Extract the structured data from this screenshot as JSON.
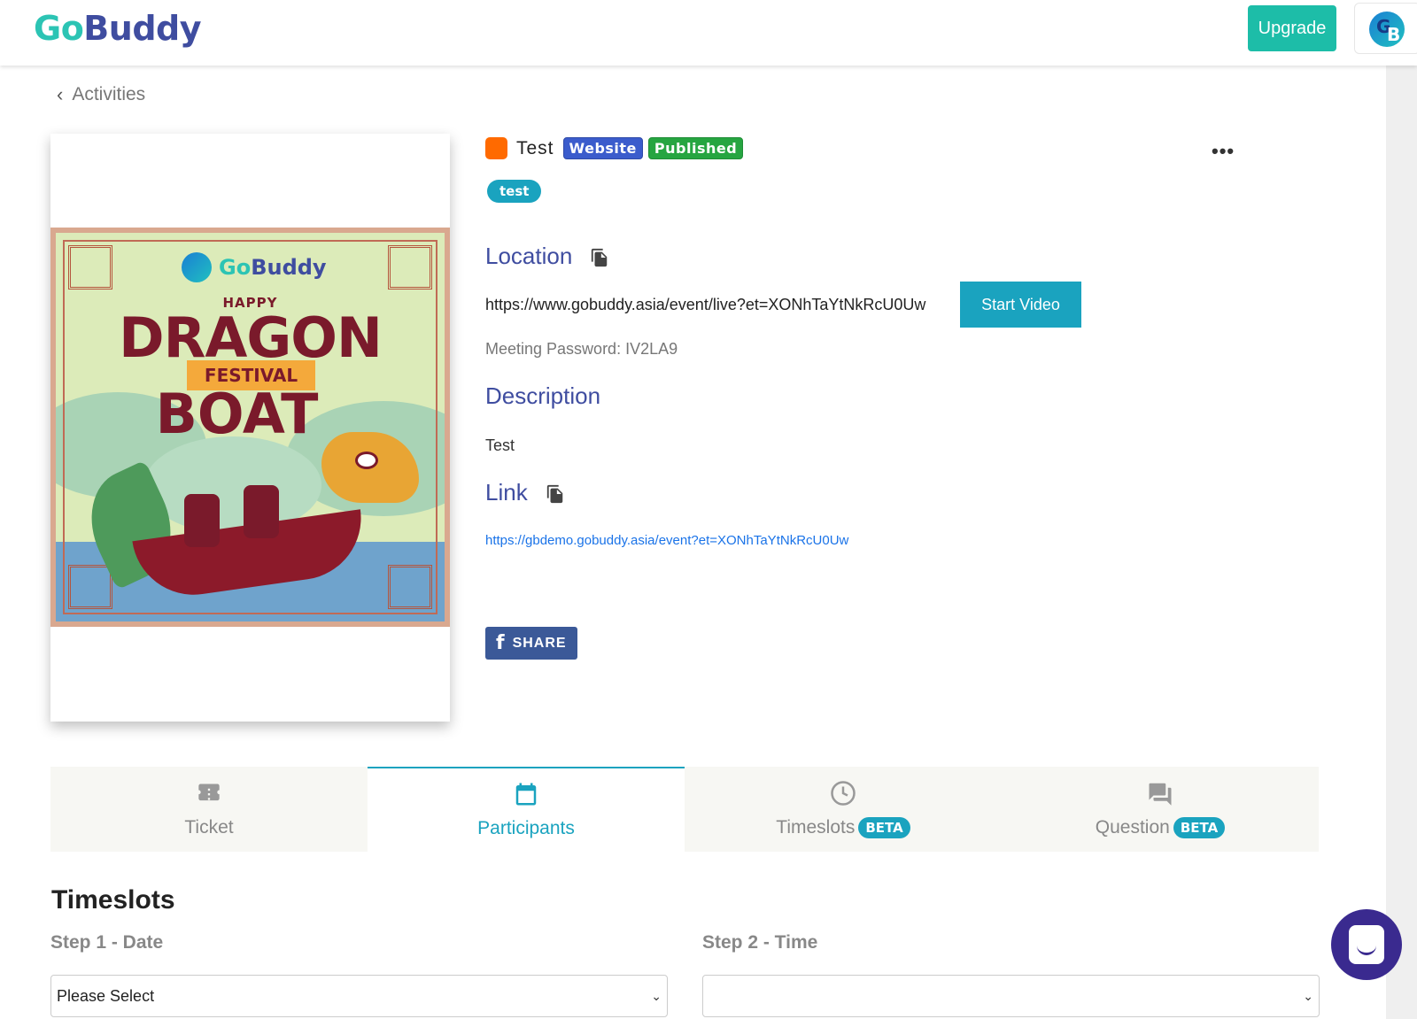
{
  "header": {
    "logo_go": "Go",
    "logo_buddy": "Buddy",
    "upgrade_label": "Upgrade",
    "avatar_g": "G",
    "avatar_b": "B"
  },
  "breadcrumb": {
    "back_label": "Activities"
  },
  "poster": {
    "logo_go": "Go",
    "logo_buddy": "Buddy",
    "happy": "HAPPY",
    "dragon": "DRAGON",
    "festival": "FESTIVAL",
    "boat": "BOAT"
  },
  "event": {
    "color": "#ff6a00",
    "title": "Test",
    "badge_website": "Website",
    "badge_published": "Published",
    "more": "•••",
    "tag": "test",
    "location_heading": "Location",
    "location_url": "https://www.gobuddy.asia/event/live?et=XONhTaYtNkRcU0Uw",
    "start_video_label": "Start Video",
    "meeting_password": "Meeting Password: IV2LA9",
    "description_heading": "Description",
    "description_text": "Test",
    "link_heading": "Link",
    "link_url": "https://gbdemo.gobuddy.asia/event?et=XONhTaYtNkRcU0Uw",
    "share_label": "SHARE",
    "share_icon": "f"
  },
  "tabs": [
    {
      "label": "Ticket",
      "icon": "ticket-icon",
      "active": false,
      "beta": ""
    },
    {
      "label": "Participants",
      "icon": "calendar-icon",
      "active": true,
      "beta": ""
    },
    {
      "label": "Timeslots",
      "icon": "clock-icon",
      "active": false,
      "beta": "BETA"
    },
    {
      "label": "Question",
      "icon": "chat-icon",
      "active": false,
      "beta": "BETA"
    }
  ],
  "timeslots": {
    "title": "Timeslots",
    "step1_label": "Step 1 - Date",
    "step1_value": "Please Select",
    "step2_label": "Step 2 - Time",
    "step2_value": ""
  },
  "colors": {
    "brand_teal": "#1aa3bf",
    "brand_indigo": "#3f4da0",
    "upgrade_green": "#1dbda8",
    "facebook_blue": "#3b5998"
  }
}
